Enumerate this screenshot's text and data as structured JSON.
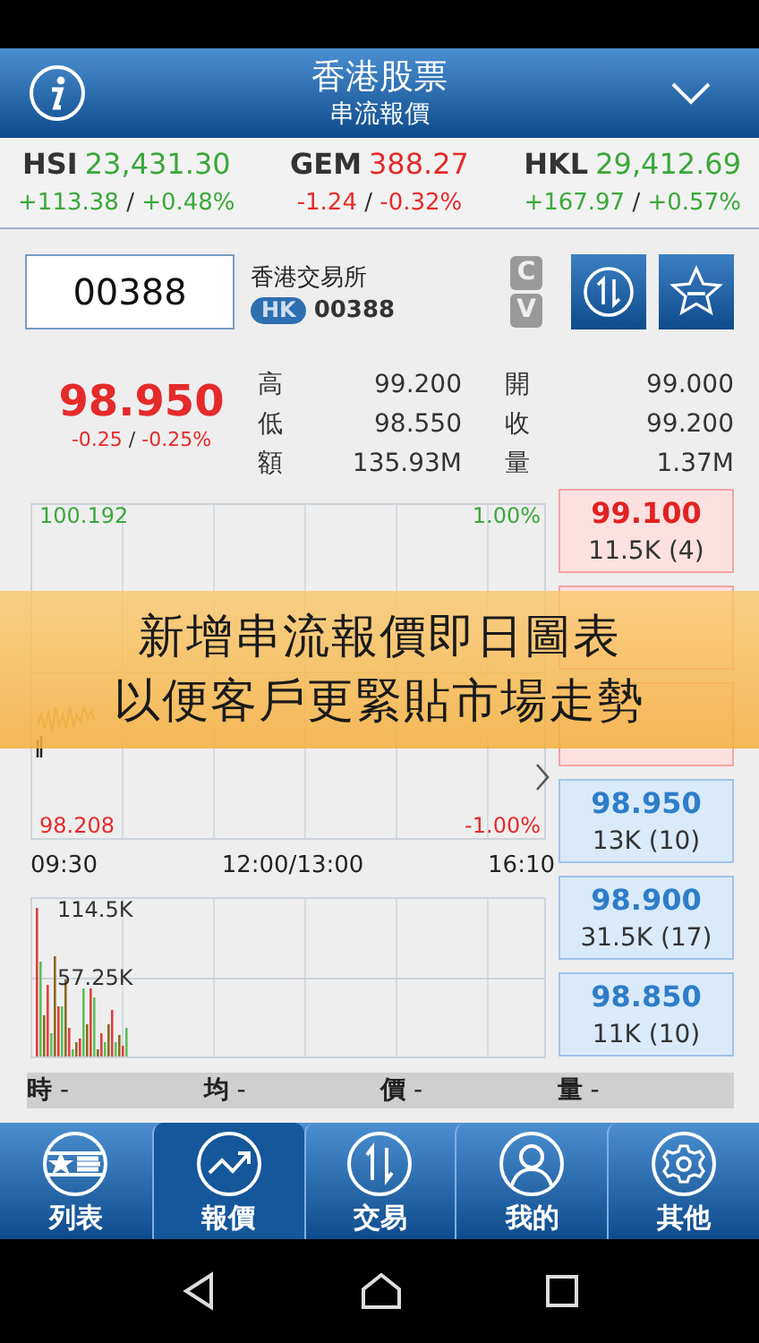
{
  "header": {
    "title": "香港股票",
    "subtitle": "串流報價"
  },
  "indices": [
    {
      "name": "HSI",
      "value": "23,431.30",
      "change": "+113.38",
      "separator": "/",
      "percent": "+0.48%",
      "color": "#3aa83a"
    },
    {
      "name": "GEM",
      "value": "388.27",
      "change": "-1.24",
      "separator": "/",
      "percent": "-0.32%",
      "color": "#e52a2a"
    },
    {
      "name": "HKL",
      "value": "29,412.69",
      "change": "+167.97",
      "separator": "/",
      "percent": "+0.57%",
      "color": "#3aa83a"
    }
  ],
  "quote": {
    "code_input": "00388",
    "name": "香港交易所",
    "market": "HK",
    "code": "00388",
    "cv_labels": [
      "C",
      "V"
    ],
    "price": "98.950",
    "change": "-0.25",
    "separator": "/",
    "percent": "-0.25%"
  },
  "stats": [
    {
      "label": "高",
      "value": "99.200"
    },
    {
      "label": "開",
      "value": "99.000"
    },
    {
      "label": "低",
      "value": "98.550"
    },
    {
      "label": "收",
      "value": "99.200"
    },
    {
      "label": "額",
      "value": "135.93M"
    },
    {
      "label": "量",
      "value": "1.37M"
    }
  ],
  "price_chart": {
    "high": "100.192",
    "high_pct": "1.00%",
    "low": "98.208",
    "low_pct": "-1.00%",
    "times": [
      "09:30",
      "12:00/13:00",
      "16:10"
    ]
  },
  "volume_chart": {
    "max": "114.5K",
    "mid": "57.25K"
  },
  "order_book": [
    {
      "kind": "ask",
      "price": "99.100",
      "volume": "11.5K (4)"
    },
    {
      "kind": "ask"
    },
    {
      "kind": "ask"
    },
    {
      "kind": "bid",
      "price": "98.950",
      "volume": "13K (10)"
    },
    {
      "kind": "bid",
      "price": "98.900",
      "volume": "31.5K (17)"
    },
    {
      "kind": "bid",
      "price": "98.850",
      "volume": "11K (10)"
    }
  ],
  "info_bar": [
    {
      "label": "時",
      "value": "-"
    },
    {
      "label": "均",
      "value": "-"
    },
    {
      "label": "價",
      "value": "-"
    },
    {
      "label": "量",
      "value": "-"
    }
  ],
  "banner": [
    "新增串流報價即日圖表",
    "以便客戶更緊貼市場走勢"
  ],
  "nav": [
    {
      "label": "列表",
      "selected": false
    },
    {
      "label": "報價",
      "selected": true
    },
    {
      "label": "交易",
      "selected": false
    },
    {
      "label": "我的",
      "selected": false
    },
    {
      "label": "其他",
      "selected": false
    }
  ]
}
